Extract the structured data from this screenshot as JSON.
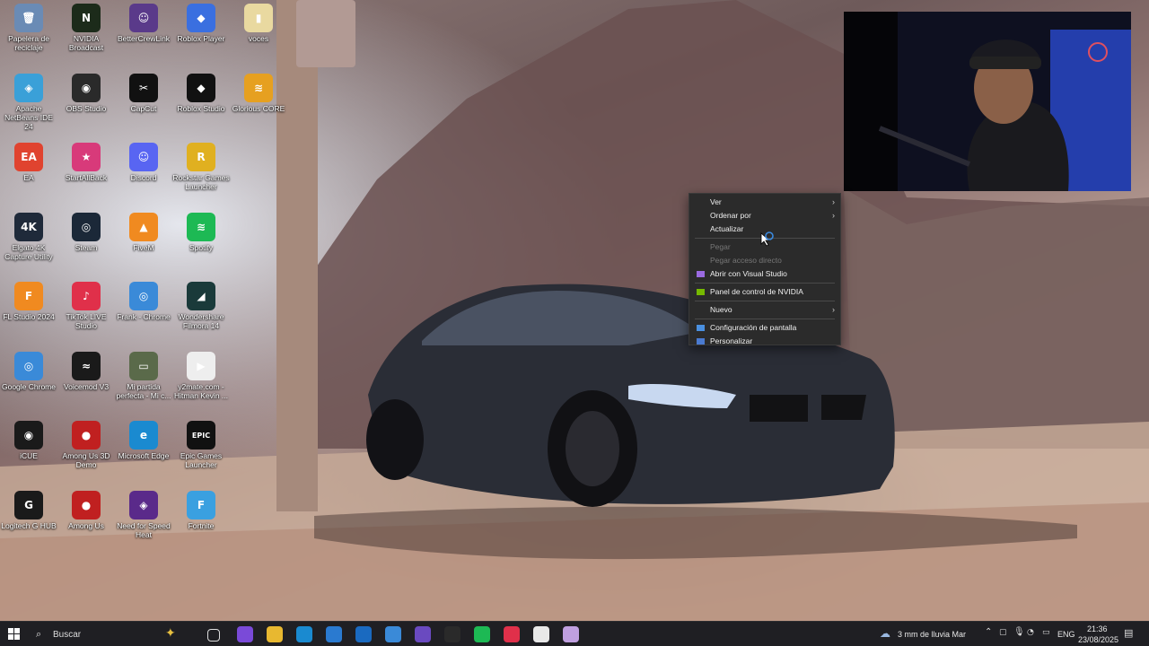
{
  "desktop": {
    "icons": [
      {
        "label": "Papelera de reciclaje",
        "col": 0,
        "row": 0,
        "color": "#6a8bb5",
        "glyph": "🗑",
        "icon": "recycle-bin-icon"
      },
      {
        "label": "NVIDIA Broadcast",
        "col": 1,
        "row": 0,
        "color": "#1c2b1a",
        "glyph": "N",
        "icon": "nvidia-broadcast-icon"
      },
      {
        "label": "BetterCrewLink",
        "col": 2,
        "row": 0,
        "color": "#5a3a8a",
        "glyph": "☺",
        "icon": "bettercrewlink-icon"
      },
      {
        "label": "Roblox Player",
        "col": 3,
        "row": 0,
        "color": "#3a6fe0",
        "glyph": "◆",
        "icon": "roblox-player-icon"
      },
      {
        "label": "voces",
        "col": 4,
        "row": 0,
        "color": "#e9d9a0",
        "glyph": "▮",
        "icon": "folder-icon"
      },
      {
        "label": "Apache NetBeans IDE 24",
        "col": 0,
        "row": 1,
        "color": "#3aa0d8",
        "glyph": "◈",
        "icon": "netbeans-icon"
      },
      {
        "label": "OBS Studio",
        "col": 1,
        "row": 1,
        "color": "#2a2a2a",
        "glyph": "◉",
        "icon": "obs-icon"
      },
      {
        "label": "CapCut",
        "col": 2,
        "row": 1,
        "color": "#111",
        "glyph": "✂",
        "icon": "capcut-icon"
      },
      {
        "label": "Roblox Studio",
        "col": 3,
        "row": 1,
        "color": "#111",
        "glyph": "◆",
        "icon": "roblox-studio-icon"
      },
      {
        "label": "Glorious CORE",
        "col": 4,
        "row": 1,
        "color": "#e6a020",
        "glyph": "≋",
        "icon": "glorious-core-icon"
      },
      {
        "label": "EA",
        "col": 0,
        "row": 2,
        "color": "#e0432f",
        "glyph": "EA",
        "icon": "ea-icon"
      },
      {
        "label": "StartAllBack",
        "col": 1,
        "row": 2,
        "color": "#d83a7a",
        "glyph": "★",
        "icon": "star-icon"
      },
      {
        "label": "Discord",
        "col": 2,
        "row": 2,
        "color": "#5865f2",
        "glyph": "☺",
        "icon": "discord-icon"
      },
      {
        "label": "Rockstar Games Launcher",
        "col": 3,
        "row": 2,
        "color": "#e0b020",
        "glyph": "R",
        "icon": "rockstar-icon"
      },
      {
        "label": "Elgato 4K Capture Utility",
        "col": 0,
        "row": 3,
        "color": "#1f2a3a",
        "glyph": "4K",
        "icon": "elgato-icon"
      },
      {
        "label": "Steam",
        "col": 1,
        "row": 3,
        "color": "#1b2838",
        "glyph": "◎",
        "icon": "steam-icon"
      },
      {
        "label": "FiveM",
        "col": 2,
        "row": 3,
        "color": "#f08a20",
        "glyph": "▲",
        "icon": "fivem-icon"
      },
      {
        "label": "Spotify",
        "col": 3,
        "row": 3,
        "color": "#1db954",
        "glyph": "≋",
        "icon": "spotify-icon"
      },
      {
        "label": "FL Studio 2024",
        "col": 0,
        "row": 4,
        "color": "#f08a20",
        "glyph": "F",
        "icon": "fl-studio-icon"
      },
      {
        "label": "TikTok LIVE Studio",
        "col": 1,
        "row": 4,
        "color": "#e0304a",
        "glyph": "♪",
        "icon": "tiktok-live-icon"
      },
      {
        "label": "Frank - Chrome",
        "col": 2,
        "row": 4,
        "color": "#3a8ad8",
        "glyph": "◎",
        "icon": "chrome-icon"
      },
      {
        "label": "Wondershare Filmora 14",
        "col": 3,
        "row": 4,
        "color": "#1a3a3a",
        "glyph": "◢",
        "icon": "filmora-icon"
      },
      {
        "label": "Google Chrome",
        "col": 0,
        "row": 5,
        "color": "#3a8ad8",
        "glyph": "◎",
        "icon": "chrome-icon"
      },
      {
        "label": "Voicemod V3",
        "col": 1,
        "row": 5,
        "color": "#1a1a1a",
        "glyph": "≈",
        "icon": "voicemod-icon"
      },
      {
        "label": "Mi partida perfecta - Mi c...",
        "col": 2,
        "row": 5,
        "color": "#5a6a4a",
        "glyph": "▭",
        "icon": "image-icon"
      },
      {
        "label": "y2mate.com - Hitman Kevin ...",
        "col": 3,
        "row": 5,
        "color": "#eee",
        "glyph": "▶",
        "icon": "video-file-icon"
      },
      {
        "label": "iCUE",
        "col": 0,
        "row": 6,
        "color": "#1a1a1a",
        "glyph": "◉",
        "icon": "icue-icon"
      },
      {
        "label": "Among Us 3D Demo",
        "col": 1,
        "row": 6,
        "color": "#c02020",
        "glyph": "●",
        "icon": "among-us-icon"
      },
      {
        "label": "Microsoft Edge",
        "col": 2,
        "row": 6,
        "color": "#1a8ad0",
        "glyph": "e",
        "icon": "edge-icon"
      },
      {
        "label": "Epic Games Launcher",
        "col": 3,
        "row": 6,
        "color": "#111",
        "glyph": "EPIC",
        "icon": "epic-games-icon"
      },
      {
        "label": "Logitech G HUB",
        "col": 0,
        "row": 7,
        "color": "#1a1a1a",
        "glyph": "G",
        "icon": "logitech-icon"
      },
      {
        "label": "Among Us",
        "col": 1,
        "row": 7,
        "color": "#c02020",
        "glyph": "●",
        "icon": "among-us-icon"
      },
      {
        "label": "Need for Speed Heat",
        "col": 2,
        "row": 7,
        "color": "#5a2a8a",
        "glyph": "◈",
        "icon": "nfs-heat-icon"
      },
      {
        "label": "Fortnite",
        "col": 3,
        "row": 7,
        "color": "#3aa0e0",
        "glyph": "F",
        "icon": "fortnite-icon"
      }
    ]
  },
  "context_menu": {
    "items": [
      {
        "type": "item",
        "label": "Ver",
        "arrow": true,
        "disabled": false,
        "icon": ""
      },
      {
        "type": "item",
        "label": "Ordenar por",
        "arrow": true,
        "disabled": false,
        "icon": ""
      },
      {
        "type": "item",
        "label": "Actualizar",
        "arrow": false,
        "disabled": false,
        "icon": ""
      },
      {
        "type": "sep"
      },
      {
        "type": "item",
        "label": "Pegar",
        "arrow": false,
        "disabled": true,
        "icon": ""
      },
      {
        "type": "item",
        "label": "Pegar acceso directo",
        "arrow": false,
        "disabled": true,
        "icon": ""
      },
      {
        "type": "item",
        "label": "Abrir con Visual Studio",
        "arrow": false,
        "disabled": false,
        "icon": "vs"
      },
      {
        "type": "sep"
      },
      {
        "type": "item",
        "label": "Panel de control de NVIDIA",
        "arrow": false,
        "disabled": false,
        "icon": "nvidia"
      },
      {
        "type": "sep"
      },
      {
        "type": "item",
        "label": "Nuevo",
        "arrow": true,
        "disabled": false,
        "icon": ""
      },
      {
        "type": "sep"
      },
      {
        "type": "item",
        "label": "Configuración de pantalla",
        "arrow": false,
        "disabled": false,
        "icon": "display"
      },
      {
        "type": "item",
        "label": "Personalizar",
        "arrow": false,
        "disabled": false,
        "icon": "personalize"
      }
    ]
  },
  "taskbar": {
    "search_placeholder": "Buscar",
    "weather": "3 mm de lluvia Mar",
    "language": "ENG",
    "time": "21:36",
    "date": "23/08/2025",
    "apps": [
      {
        "icon": "task-view-icon",
        "color": "#2a2a2e"
      },
      {
        "icon": "copilot-icon",
        "color": "#7a4ad8"
      },
      {
        "icon": "file-explorer-icon",
        "color": "#e8b830"
      },
      {
        "icon": "edge-icon",
        "color": "#1a8ad0"
      },
      {
        "icon": "store-icon",
        "color": "#2a7ad0"
      },
      {
        "icon": "outlook-icon",
        "color": "#1a6ac0"
      },
      {
        "icon": "chrome-icon",
        "color": "#3a8ad8"
      },
      {
        "icon": "bettercrewlink-icon",
        "color": "#6a4ac0"
      },
      {
        "icon": "obs-icon",
        "color": "#2a2a2a"
      },
      {
        "icon": "spotify-icon",
        "color": "#1db954"
      },
      {
        "icon": "tiktok-live-icon",
        "color": "#e0304a"
      },
      {
        "icon": "capcut-icon",
        "color": "#e8e8e8"
      },
      {
        "icon": "app-icon",
        "color": "#c0a0e0"
      }
    ]
  }
}
